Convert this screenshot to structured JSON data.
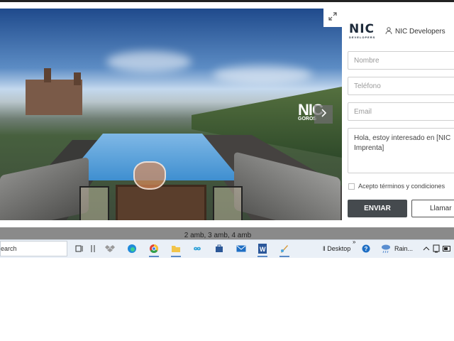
{
  "hero": {
    "image_sign_text": "NIC",
    "image_sign_sub": "GOROS"
  },
  "brand": {
    "logo_text": "NIC",
    "logo_sub": "DEVELOPERS",
    "developer_link": "NIC Developers"
  },
  "form": {
    "name_placeholder": "Nombre",
    "phone_placeholder": "Teléfono",
    "email_placeholder": "Email",
    "message_value": "Hola, estoy interesado en [NIC Imprenta]",
    "terms_label": "Acepto términos y condiciones",
    "send_label": "ENVIAR",
    "call_label": "Llamar"
  },
  "listing": {
    "rooms_text": "2 amb, 3 amb, 4 amb"
  },
  "taskbar": {
    "search_text": "earch",
    "desktop_label": "Desktop",
    "weather_label": "Rain...",
    "chevron_label": "»",
    "icons": [
      "task-view-icon",
      "widgets-icon",
      "dropbox-icon",
      "edge-icon",
      "chrome-icon",
      "file-explorer-icon",
      "infinity-app-icon",
      "store-icon",
      "mail-icon",
      "word-icon",
      "paint-icon"
    ]
  },
  "colors": {
    "send_button": "#454a4e",
    "strip": "#8a8a8a",
    "taskbar": "#eaf0f7",
    "brand": "#1d2a3a"
  }
}
